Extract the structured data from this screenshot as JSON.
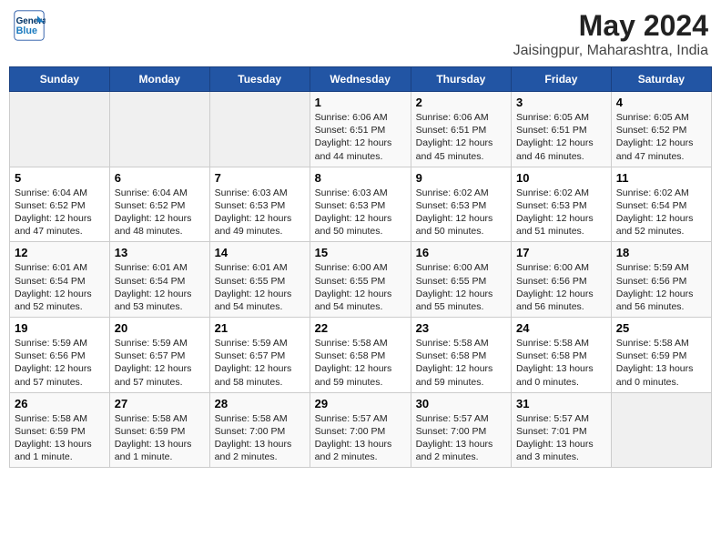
{
  "header": {
    "logo_line1": "General",
    "logo_line2": "Blue",
    "title": "May 2024",
    "subtitle": "Jaisingpur, Maharashtra, India"
  },
  "weekdays": [
    "Sunday",
    "Monday",
    "Tuesday",
    "Wednesday",
    "Thursday",
    "Friday",
    "Saturday"
  ],
  "weeks": [
    [
      {
        "num": "",
        "info": ""
      },
      {
        "num": "",
        "info": ""
      },
      {
        "num": "",
        "info": ""
      },
      {
        "num": "1",
        "info": "Sunrise: 6:06 AM\nSunset: 6:51 PM\nDaylight: 12 hours\nand 44 minutes."
      },
      {
        "num": "2",
        "info": "Sunrise: 6:06 AM\nSunset: 6:51 PM\nDaylight: 12 hours\nand 45 minutes."
      },
      {
        "num": "3",
        "info": "Sunrise: 6:05 AM\nSunset: 6:51 PM\nDaylight: 12 hours\nand 46 minutes."
      },
      {
        "num": "4",
        "info": "Sunrise: 6:05 AM\nSunset: 6:52 PM\nDaylight: 12 hours\nand 47 minutes."
      }
    ],
    [
      {
        "num": "5",
        "info": "Sunrise: 6:04 AM\nSunset: 6:52 PM\nDaylight: 12 hours\nand 47 minutes."
      },
      {
        "num": "6",
        "info": "Sunrise: 6:04 AM\nSunset: 6:52 PM\nDaylight: 12 hours\nand 48 minutes."
      },
      {
        "num": "7",
        "info": "Sunrise: 6:03 AM\nSunset: 6:53 PM\nDaylight: 12 hours\nand 49 minutes."
      },
      {
        "num": "8",
        "info": "Sunrise: 6:03 AM\nSunset: 6:53 PM\nDaylight: 12 hours\nand 50 minutes."
      },
      {
        "num": "9",
        "info": "Sunrise: 6:02 AM\nSunset: 6:53 PM\nDaylight: 12 hours\nand 50 minutes."
      },
      {
        "num": "10",
        "info": "Sunrise: 6:02 AM\nSunset: 6:53 PM\nDaylight: 12 hours\nand 51 minutes."
      },
      {
        "num": "11",
        "info": "Sunrise: 6:02 AM\nSunset: 6:54 PM\nDaylight: 12 hours\nand 52 minutes."
      }
    ],
    [
      {
        "num": "12",
        "info": "Sunrise: 6:01 AM\nSunset: 6:54 PM\nDaylight: 12 hours\nand 52 minutes."
      },
      {
        "num": "13",
        "info": "Sunrise: 6:01 AM\nSunset: 6:54 PM\nDaylight: 12 hours\nand 53 minutes."
      },
      {
        "num": "14",
        "info": "Sunrise: 6:01 AM\nSunset: 6:55 PM\nDaylight: 12 hours\nand 54 minutes."
      },
      {
        "num": "15",
        "info": "Sunrise: 6:00 AM\nSunset: 6:55 PM\nDaylight: 12 hours\nand 54 minutes."
      },
      {
        "num": "16",
        "info": "Sunrise: 6:00 AM\nSunset: 6:55 PM\nDaylight: 12 hours\nand 55 minutes."
      },
      {
        "num": "17",
        "info": "Sunrise: 6:00 AM\nSunset: 6:56 PM\nDaylight: 12 hours\nand 56 minutes."
      },
      {
        "num": "18",
        "info": "Sunrise: 5:59 AM\nSunset: 6:56 PM\nDaylight: 12 hours\nand 56 minutes."
      }
    ],
    [
      {
        "num": "19",
        "info": "Sunrise: 5:59 AM\nSunset: 6:56 PM\nDaylight: 12 hours\nand 57 minutes."
      },
      {
        "num": "20",
        "info": "Sunrise: 5:59 AM\nSunset: 6:57 PM\nDaylight: 12 hours\nand 57 minutes."
      },
      {
        "num": "21",
        "info": "Sunrise: 5:59 AM\nSunset: 6:57 PM\nDaylight: 12 hours\nand 58 minutes."
      },
      {
        "num": "22",
        "info": "Sunrise: 5:58 AM\nSunset: 6:58 PM\nDaylight: 12 hours\nand 59 minutes."
      },
      {
        "num": "23",
        "info": "Sunrise: 5:58 AM\nSunset: 6:58 PM\nDaylight: 12 hours\nand 59 minutes."
      },
      {
        "num": "24",
        "info": "Sunrise: 5:58 AM\nSunset: 6:58 PM\nDaylight: 13 hours\nand 0 minutes."
      },
      {
        "num": "25",
        "info": "Sunrise: 5:58 AM\nSunset: 6:59 PM\nDaylight: 13 hours\nand 0 minutes."
      }
    ],
    [
      {
        "num": "26",
        "info": "Sunrise: 5:58 AM\nSunset: 6:59 PM\nDaylight: 13 hours\nand 1 minute."
      },
      {
        "num": "27",
        "info": "Sunrise: 5:58 AM\nSunset: 6:59 PM\nDaylight: 13 hours\nand 1 minute."
      },
      {
        "num": "28",
        "info": "Sunrise: 5:58 AM\nSunset: 7:00 PM\nDaylight: 13 hours\nand 2 minutes."
      },
      {
        "num": "29",
        "info": "Sunrise: 5:57 AM\nSunset: 7:00 PM\nDaylight: 13 hours\nand 2 minutes."
      },
      {
        "num": "30",
        "info": "Sunrise: 5:57 AM\nSunset: 7:00 PM\nDaylight: 13 hours\nand 2 minutes."
      },
      {
        "num": "31",
        "info": "Sunrise: 5:57 AM\nSunset: 7:01 PM\nDaylight: 13 hours\nand 3 minutes."
      },
      {
        "num": "",
        "info": ""
      }
    ]
  ]
}
